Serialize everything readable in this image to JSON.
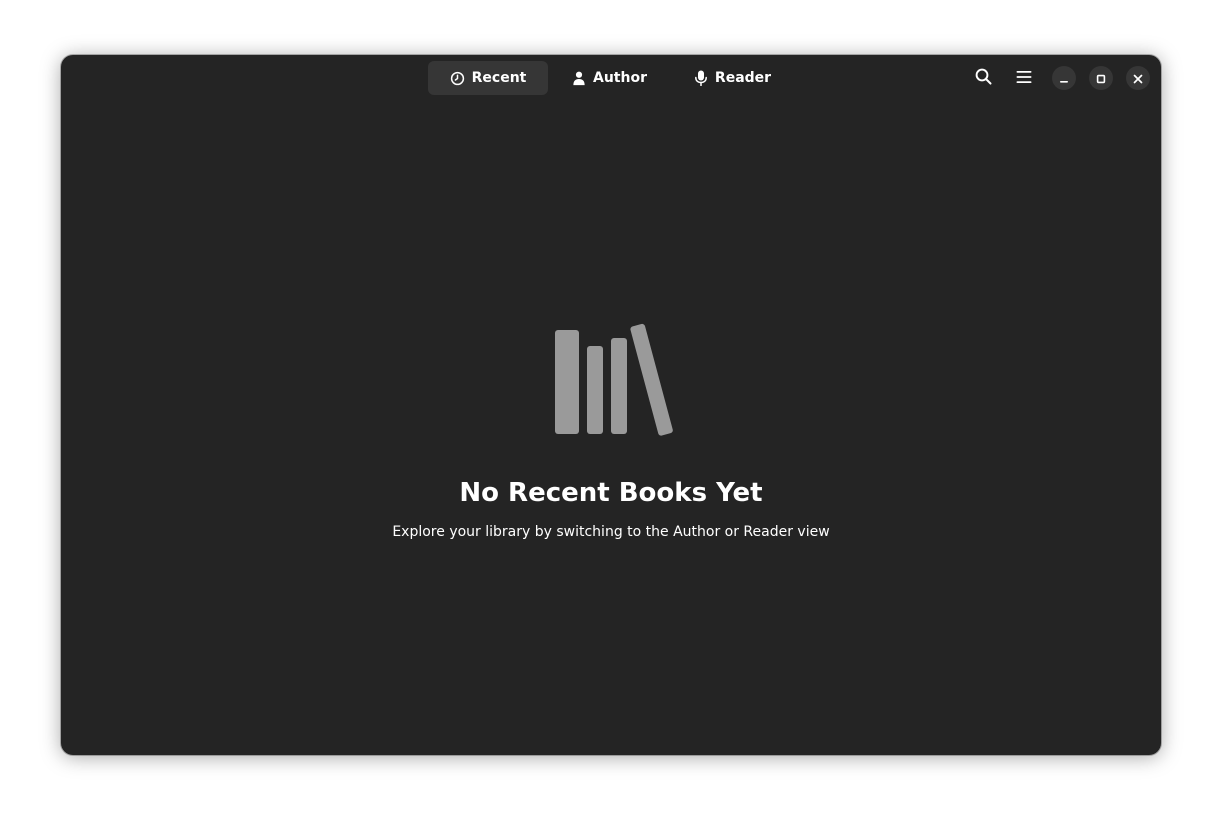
{
  "headerbar": {
    "tabs": [
      {
        "label": "Recent",
        "icon": "clock-icon",
        "active": true
      },
      {
        "label": "Author",
        "icon": "person-icon",
        "active": false
      },
      {
        "label": "Reader",
        "icon": "microphone-icon",
        "active": false
      }
    ],
    "buttons": {
      "search": "search-icon",
      "menu": "hamburger-menu-icon"
    },
    "window_controls": {
      "minimize": "minimize-icon",
      "maximize": "maximize-icon",
      "close": "close-icon"
    }
  },
  "status": {
    "icon": "books-icon",
    "title": "No Recent Books Yet",
    "description": "Explore your library by switching to the Author or Reader view"
  },
  "colors": {
    "window_bg": "#242424",
    "active_tab_bg": "#363636",
    "icon_gray": "#9a9a9a",
    "text": "#ffffff"
  }
}
